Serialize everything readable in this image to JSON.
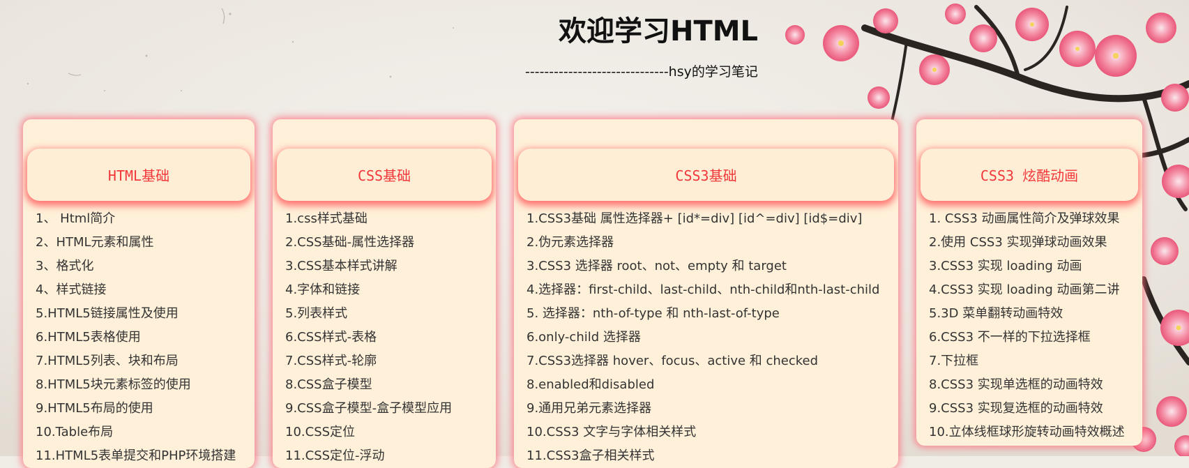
{
  "page": {
    "title": "欢迎学习HTML",
    "subtitle": "------------------------------hsy的学习笔记"
  },
  "theme": {
    "card_bg": "#fff0d9",
    "accent": "#f2373a",
    "glow": "#ff6978",
    "text": "#333333"
  },
  "cards": [
    {
      "title": "HTML基础",
      "items": [
        "1、 Html简介",
        "2、HTML元素和属性",
        "3、格式化",
        "4、样式链接",
        "5.HTML5链接属性及使用",
        "6.HTML5表格使用",
        "7.HTML5列表、块和布局",
        "8.HTML5块元素标签的使用",
        "9.HTML5布局的使用",
        "10.Table布局",
        "11.HTML5表单提交和PHP环境搭建"
      ]
    },
    {
      "title": "CSS基础",
      "items": [
        "1.css样式基础",
        "2.CSS基础-属性选择器",
        "3.CSS基本样式讲解",
        "4.字体和链接",
        "5.列表样式",
        "6.CSS样式-表格",
        "7.CSS样式-轮廓",
        "8.CSS盒子模型",
        "9.CSS盒子模型-盒子模型应用",
        "10.CSS定位",
        "11.CSS定位-浮动"
      ]
    },
    {
      "title": "CSS3基础",
      "items": [
        "1.CSS3基础 属性选择器+ [id*=div] [id^=div] [id$=div]",
        "2.伪元素选择器",
        "3.CSS3 选择器 root、not、empty 和 target",
        "4.选择器：first-child、last-child、nth-child和nth-last-child",
        "5. 选择器：nth-of-type 和 nth-last-of-type",
        "6.only-child 选择器",
        "7.CSS3选择器 hover、focus、active 和 checked",
        "8.enabled和disabled",
        "9.通用兄弟元素选择器",
        "10.CSS3 文字与字体相关样式",
        "11.CSS3盒子相关样式"
      ]
    },
    {
      "title": "CSS3 炫酷动画",
      "items": [
        "1. CSS3 动画属性简介及弹球效果",
        "2.使用 CSS3 实现弹球动画效果",
        "3.CSS3 实现 loading 动画",
        "4.CSS3 实现 loading 动画第二讲",
        "5.3D 菜单翻转动画特效",
        "6.CSS3 不一样的下拉选择框",
        "7.下拉框",
        "8.CSS3 实现单选框的动画特效",
        "9.CSS3 实现复选框的动画特效",
        "10.立体线框球形旋转动画特效概述"
      ]
    }
  ]
}
